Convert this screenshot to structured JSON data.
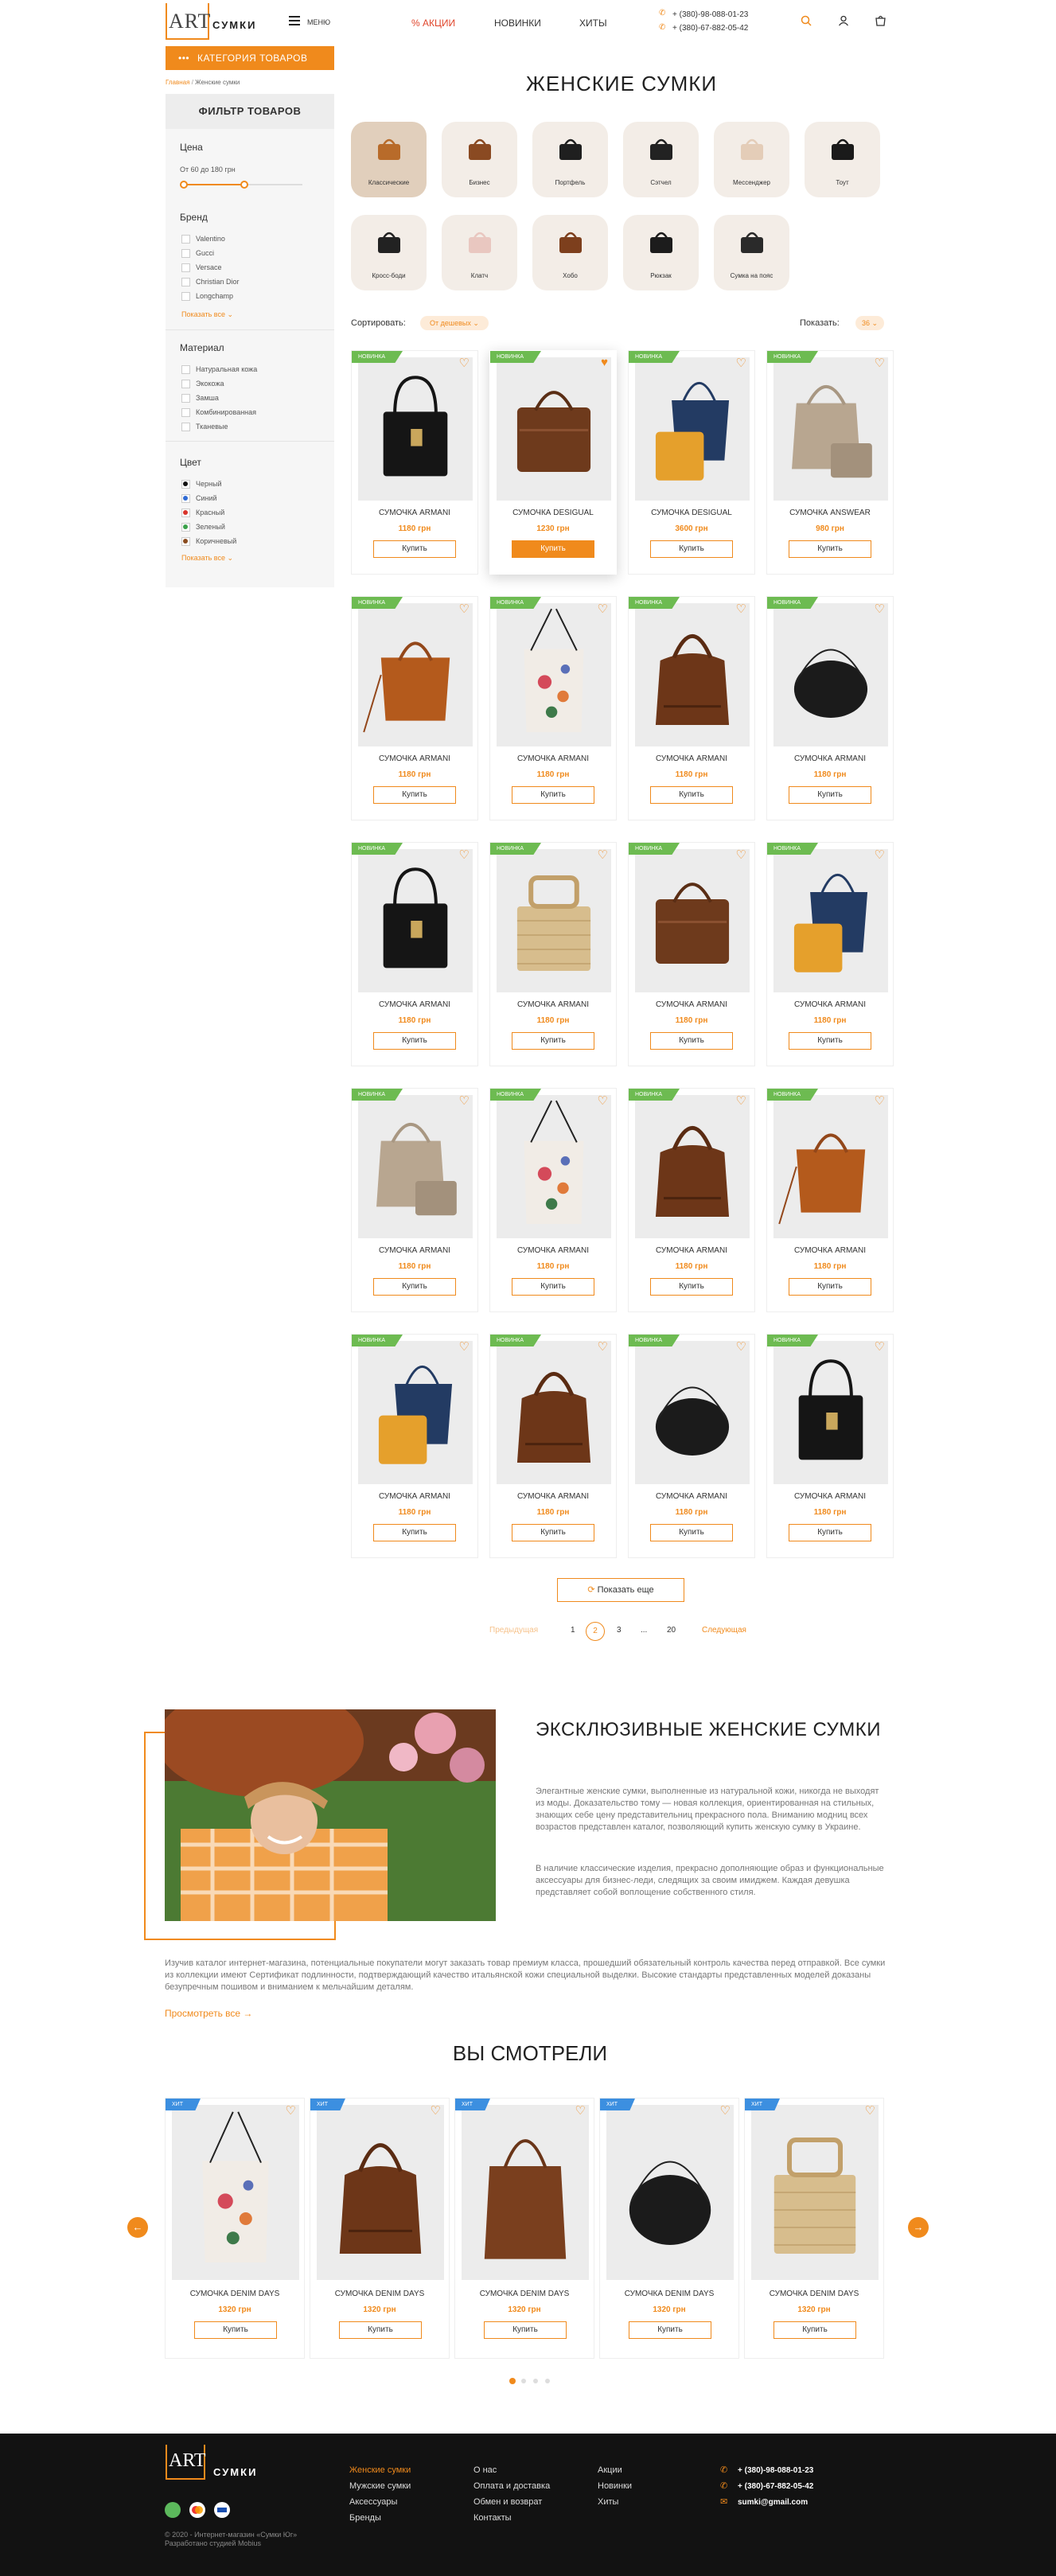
{
  "header": {
    "logo_art": "ART",
    "logo_text": "СУМКИ",
    "menu_label": "МЕНЮ",
    "nav": [
      "% АКЦИИ",
      "НОВИНКИ",
      "ХИТЫ"
    ],
    "phones": [
      "+ (380)-98-088-01-23",
      "+ (380)-67-882-05-42"
    ]
  },
  "sidebar": {
    "category_button": "КАТЕГОРИЯ ТОВАРОВ",
    "breadcrumb": {
      "home": "Главная",
      "current": "Женские сумки"
    },
    "filter_title": "ФИЛЬТР ТОВАРОВ",
    "price": {
      "title": "Цена",
      "range": "От 60 до 180 грн",
      "fill_fraction": 0.5
    },
    "brand": {
      "title": "Бренд",
      "items": [
        "Valentino",
        "Gucci",
        "Versace",
        "Christian Dior",
        "Longchamp"
      ],
      "show_all": "Показать все"
    },
    "material": {
      "title": "Материал",
      "items": [
        "Натуральная кожа",
        "Экокожа",
        "Замша",
        "Комбинированная",
        "Тканевые"
      ]
    },
    "color": {
      "title": "Цвет",
      "items": [
        {
          "label": "Черный",
          "color": "#111111"
        },
        {
          "label": "Синий",
          "color": "#2f6bd4"
        },
        {
          "label": "Красный",
          "color": "#d9342b"
        },
        {
          "label": "Зеленый",
          "color": "#3aa14a"
        },
        {
          "label": "Коричневый",
          "color": "#8a4b1e"
        }
      ],
      "show_all": "Показать все"
    }
  },
  "main": {
    "title": "ЖЕНСКИЕ СУМКИ",
    "categories": [
      "Классические",
      "Бизнес",
      "Портфель",
      "Сэтчел",
      "Мессенджер",
      "Тоут",
      "Кросс-боди",
      "Клатч",
      "Хобо",
      "Рюкзак",
      "Сумка на пояс"
    ],
    "sort_label": "Сортировать:",
    "sort_value": "От дешевых",
    "show_label": "Показать:",
    "show_value": "36",
    "products": [
      {
        "badge": "НОВИНКА",
        "name": "СУМОЧКА ARMANI",
        "price": "1180 грн",
        "buy": "Купить",
        "img": "black"
      },
      {
        "badge": "НОВИНКА",
        "name": "СУМОЧКА DESIGUAL",
        "price": "1230 грн",
        "buy": "Купить",
        "img": "brown",
        "active": true
      },
      {
        "badge": "НОВИНКА",
        "name": "СУМОЧКА DESIGUAL",
        "price": "3600 грн",
        "buy": "Купить",
        "img": "tote2"
      },
      {
        "badge": "НОВИНКА",
        "name": "СУМОЧКА ANSWEAR",
        "price": "980 грн",
        "buy": "Купить",
        "img": "beige"
      },
      {
        "badge": "НОВИНКА",
        "name": "СУМОЧКА ARMANI",
        "price": "1180 грн",
        "buy": "Купить",
        "img": "tan"
      },
      {
        "badge": "НОВИНКА",
        "name": "СУМОЧКА ARMANI",
        "price": "1180 грн",
        "buy": "Купить",
        "img": "floral"
      },
      {
        "badge": "НОВИНКА",
        "name": "СУМОЧКА ARMANI",
        "price": "1180 грн",
        "buy": "Купить",
        "img": "hobo"
      },
      {
        "badge": "НОВИНКА",
        "name": "СУМОЧКА ARMANI",
        "price": "1180 грн",
        "buy": "Купить",
        "img": "blackcross"
      },
      {
        "badge": "НОВИНКА",
        "name": "СУМОЧКА ARMANI",
        "price": "1180 грн",
        "buy": "Купить",
        "img": "black"
      },
      {
        "badge": "НОВИНКА",
        "name": "СУМОЧКА ARMANI",
        "price": "1180 грн",
        "buy": "Купить",
        "img": "straw"
      },
      {
        "badge": "НОВИНКА",
        "name": "СУМОЧКА ARMANI",
        "price": "1180 грн",
        "buy": "Купить",
        "img": "brown"
      },
      {
        "badge": "НОВИНКА",
        "name": "СУМОЧКА ARMANI",
        "price": "1180 грн",
        "buy": "Купить",
        "img": "tote2"
      },
      {
        "badge": "НОВИНКА",
        "name": "СУМОЧКА ARMANI",
        "price": "1180 грн",
        "buy": "Купить",
        "img": "beige"
      },
      {
        "badge": "НОВИНКА",
        "name": "СУМОЧКА ARMANI",
        "price": "1180 грн",
        "buy": "Купить",
        "img": "floral"
      },
      {
        "badge": "НОВИНКА",
        "name": "СУМОЧКА ARMANI",
        "price": "1180 грн",
        "buy": "Купить",
        "img": "hobo"
      },
      {
        "badge": "НОВИНКА",
        "name": "СУМОЧКА ARMANI",
        "price": "1180 грн",
        "buy": "Купить",
        "img": "tan"
      },
      {
        "badge": "НОВИНКА",
        "name": "СУМОЧКА ARMANI",
        "price": "1180 грн",
        "buy": "Купить",
        "img": "tote2"
      },
      {
        "badge": "НОВИНКА",
        "name": "СУМОЧКА ARMANI",
        "price": "1180 грн",
        "buy": "Купить",
        "img": "hobo"
      },
      {
        "badge": "НОВИНКА",
        "name": "СУМОЧКА ARMANI",
        "price": "1180 грн",
        "buy": "Купить",
        "img": "blackcross"
      },
      {
        "badge": "НОВИНКА",
        "name": "СУМОЧКА ARMANI",
        "price": "1180 грн",
        "buy": "Купить",
        "img": "black"
      }
    ],
    "show_more": "Показать еще",
    "pagination": {
      "prev": "Предыдущая",
      "pages": [
        "1",
        "2",
        "3",
        "...",
        "20"
      ],
      "current": "2",
      "next": "Следующая"
    }
  },
  "promo": {
    "title": "ЭКСКЛЮЗИВНЫЕ ЖЕНСКИЕ СУМКИ",
    "p1": "Элегантные женские сумки, выполненные из натуральной кожи, никогда не выходят из моды. Доказательство тому — новая коллекция, ориентированная на стильных, знающих себе цену представительниц прекрасного пола. Вниманию модниц всех возрастов представлен каталог, позволяющий купить женскую сумку в Украине.",
    "p2": "В наличие классические изделия, прекрасно дополняющие образ и функциональные аксессуары для бизнес-леди, следящих за своим имиджем. Каждая девушка представляет собой воплощение собственного стиля.",
    "bottom": "Изучив каталог интернет-магазина, потенциальные покупатели могут заказать товар премиум класса, прошедший обязательный контроль качества перед отправкой. Все сумки из коллекции имеют Сертификат подлинности, подтверждающий качество итальянской кожи специальной выделки. Высокие стандарты представленных моделей доказаны безупречным пошивом и вниманием к мельчайшим деталям.",
    "view_all": "Просмотреть все"
  },
  "viewed": {
    "title": "ВЫ СМОТРЕЛИ",
    "items": [
      {
        "badge": "ХИТ",
        "name": "СУМОЧКА DENIM DAYS",
        "price": "1320 грн",
        "buy": "Купить",
        "img": "floral"
      },
      {
        "badge": "ХИТ",
        "name": "СУМОЧКА DENIM DAYS",
        "price": "1320 грн",
        "buy": "Купить",
        "img": "hobo"
      },
      {
        "badge": "ХИТ",
        "name": "СУМОЧКА DENIM DAYS",
        "price": "1320 грн",
        "buy": "Купить",
        "img": "brownbig"
      },
      {
        "badge": "ХИТ",
        "name": "СУМОЧКА DENIM DAYS",
        "price": "1320 грн",
        "buy": "Купить",
        "img": "blackcross"
      },
      {
        "badge": "ХИТ",
        "name": "СУМОЧКА DENIM DAYS",
        "price": "1320 грн",
        "buy": "Купить",
        "img": "straw"
      }
    ]
  },
  "footer": {
    "logo_art": "ART",
    "logo_text": "СУМКИ",
    "copyright": "© 2020 - Интернет-магазин «Сумки Юг»",
    "developer": "Разработано студией Mobius",
    "col1": [
      "Женские сумки",
      "Мужские сумки",
      "Аксессуары",
      "Бренды"
    ],
    "col2": [
      "О нас",
      "Оплата и доставка",
      "Обмен и возврат",
      "Контакты"
    ],
    "col3": [
      "Акции",
      "Новинки",
      "Хиты"
    ],
    "phones": [
      "+ (380)-98-088-01-23",
      "+ (380)-67-882-05-42"
    ],
    "email": "sumki@gmail.com"
  },
  "colors": {
    "accent": "#f08a1c",
    "badge_new": "#6dbb51",
    "badge_hit": "#3c8fe0",
    "footer_bg": "#121212"
  }
}
